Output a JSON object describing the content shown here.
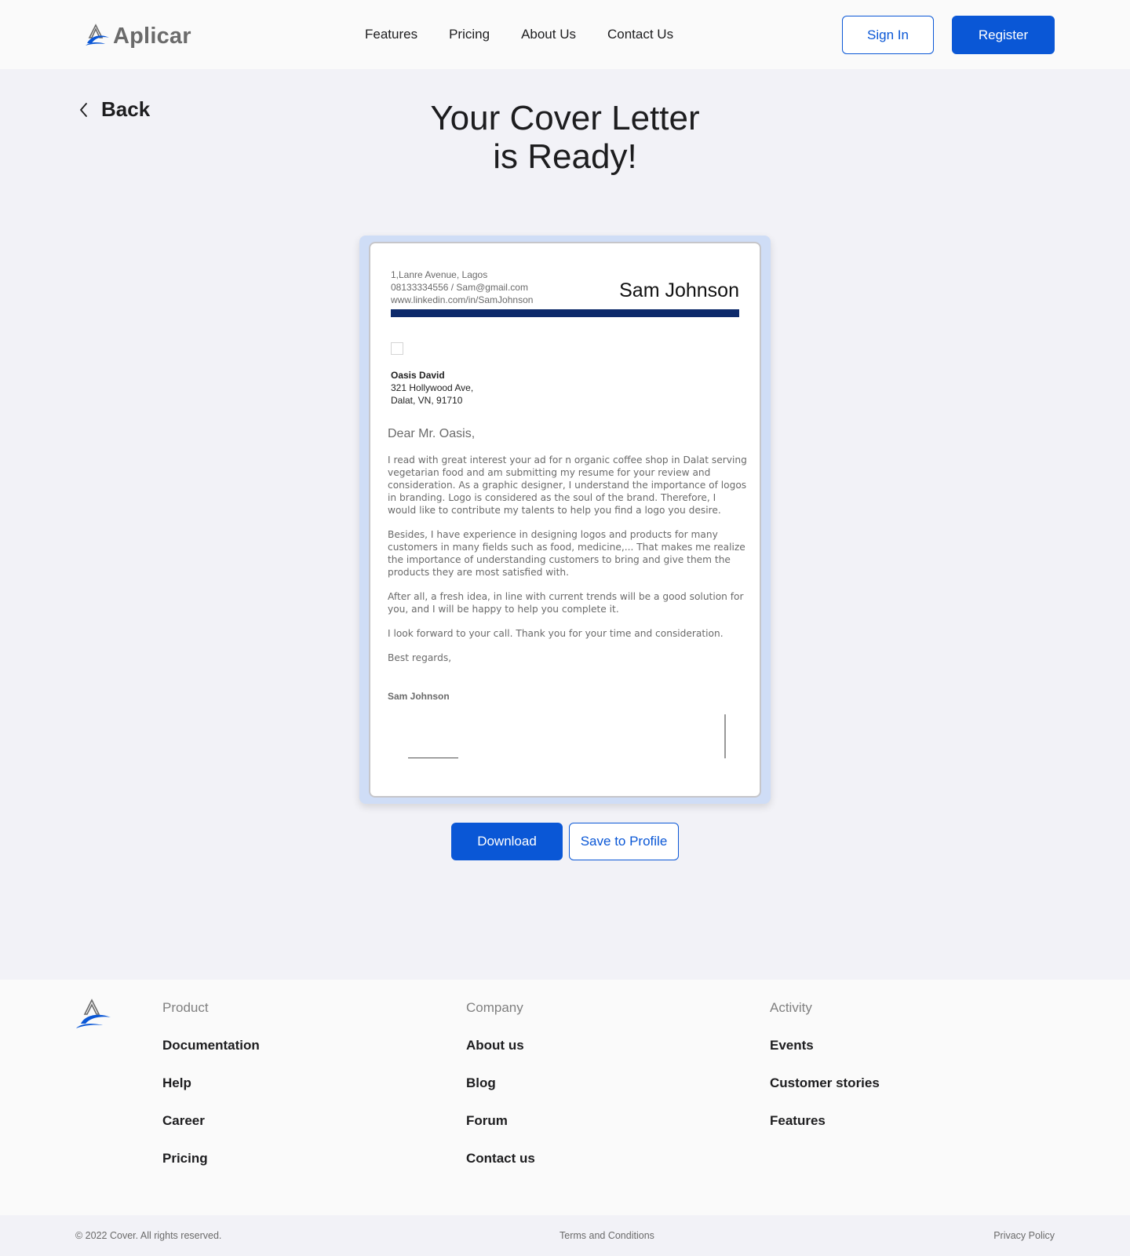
{
  "header": {
    "brand": "Aplicar",
    "nav": [
      "Features",
      "Pricing",
      "About Us",
      "Contact Us"
    ],
    "sign_in": "Sign In",
    "register": "Register"
  },
  "page": {
    "back_label": "Back",
    "title_line1": "Your Cover Letter",
    "title_line2": "is Ready!"
  },
  "letter": {
    "address": "1,Lanre Avenue, Lagos",
    "phone_email": "08133334556 / Sam@gmail.com",
    "linkedin": "www.linkedin.com/in/SamJohnson",
    "sender_name": "Sam Johnson",
    "recipient_name": "Oasis David",
    "recipient_street": "321 Hollywood Ave,",
    "recipient_city": "Dalat, VN, 91710",
    "greeting": "Dear Mr. Oasis,",
    "paragraphs": [
      "I read with great interest your ad for n organic coffee shop in Dalat serving vegetarian food and am submitting my resume for your review and consideration. As a graphic designer, I understand the importance of logos in branding. Logo is considered as the soul of the brand. Therefore, I would like to contribute my talents to help you find a logo you desire.",
      "Besides, I have experience in designing logos and products for many customers in many fields such as food, medicine,... That makes me realize the importance of understanding customers to bring and give them the products they are most satisfied with.",
      "After all, a fresh idea, in line with current trends will be a good solution for you, and I will be happy to help you complete it.",
      "I look forward to your call. Thank you for your time and consideration.",
      "Best regards,"
    ],
    "signature_name": "Sam Johnson"
  },
  "actions": {
    "download": "Download",
    "save": "Save to Profile"
  },
  "footer": {
    "columns": [
      {
        "heading": "Product",
        "links": [
          "Documentation",
          "Help",
          "Career",
          "Pricing"
        ]
      },
      {
        "heading": "Company",
        "links": [
          "About us",
          "Blog",
          "Forum",
          "Contact us"
        ]
      },
      {
        "heading": "Activity",
        "links": [
          "Events",
          "Customer stories",
          "Features"
        ]
      }
    ],
    "copyright": "© 2022 Cover. All rights reserved.",
    "terms": "Terms and Conditions",
    "privacy": "Privacy Policy"
  },
  "colors": {
    "primary": "#0a57d6",
    "letter_bar": "#0d2a6b",
    "frame": "#cfddf6"
  },
  "icons": {
    "brand": "aplicar-logo-icon",
    "back": "chevron-left-icon"
  }
}
